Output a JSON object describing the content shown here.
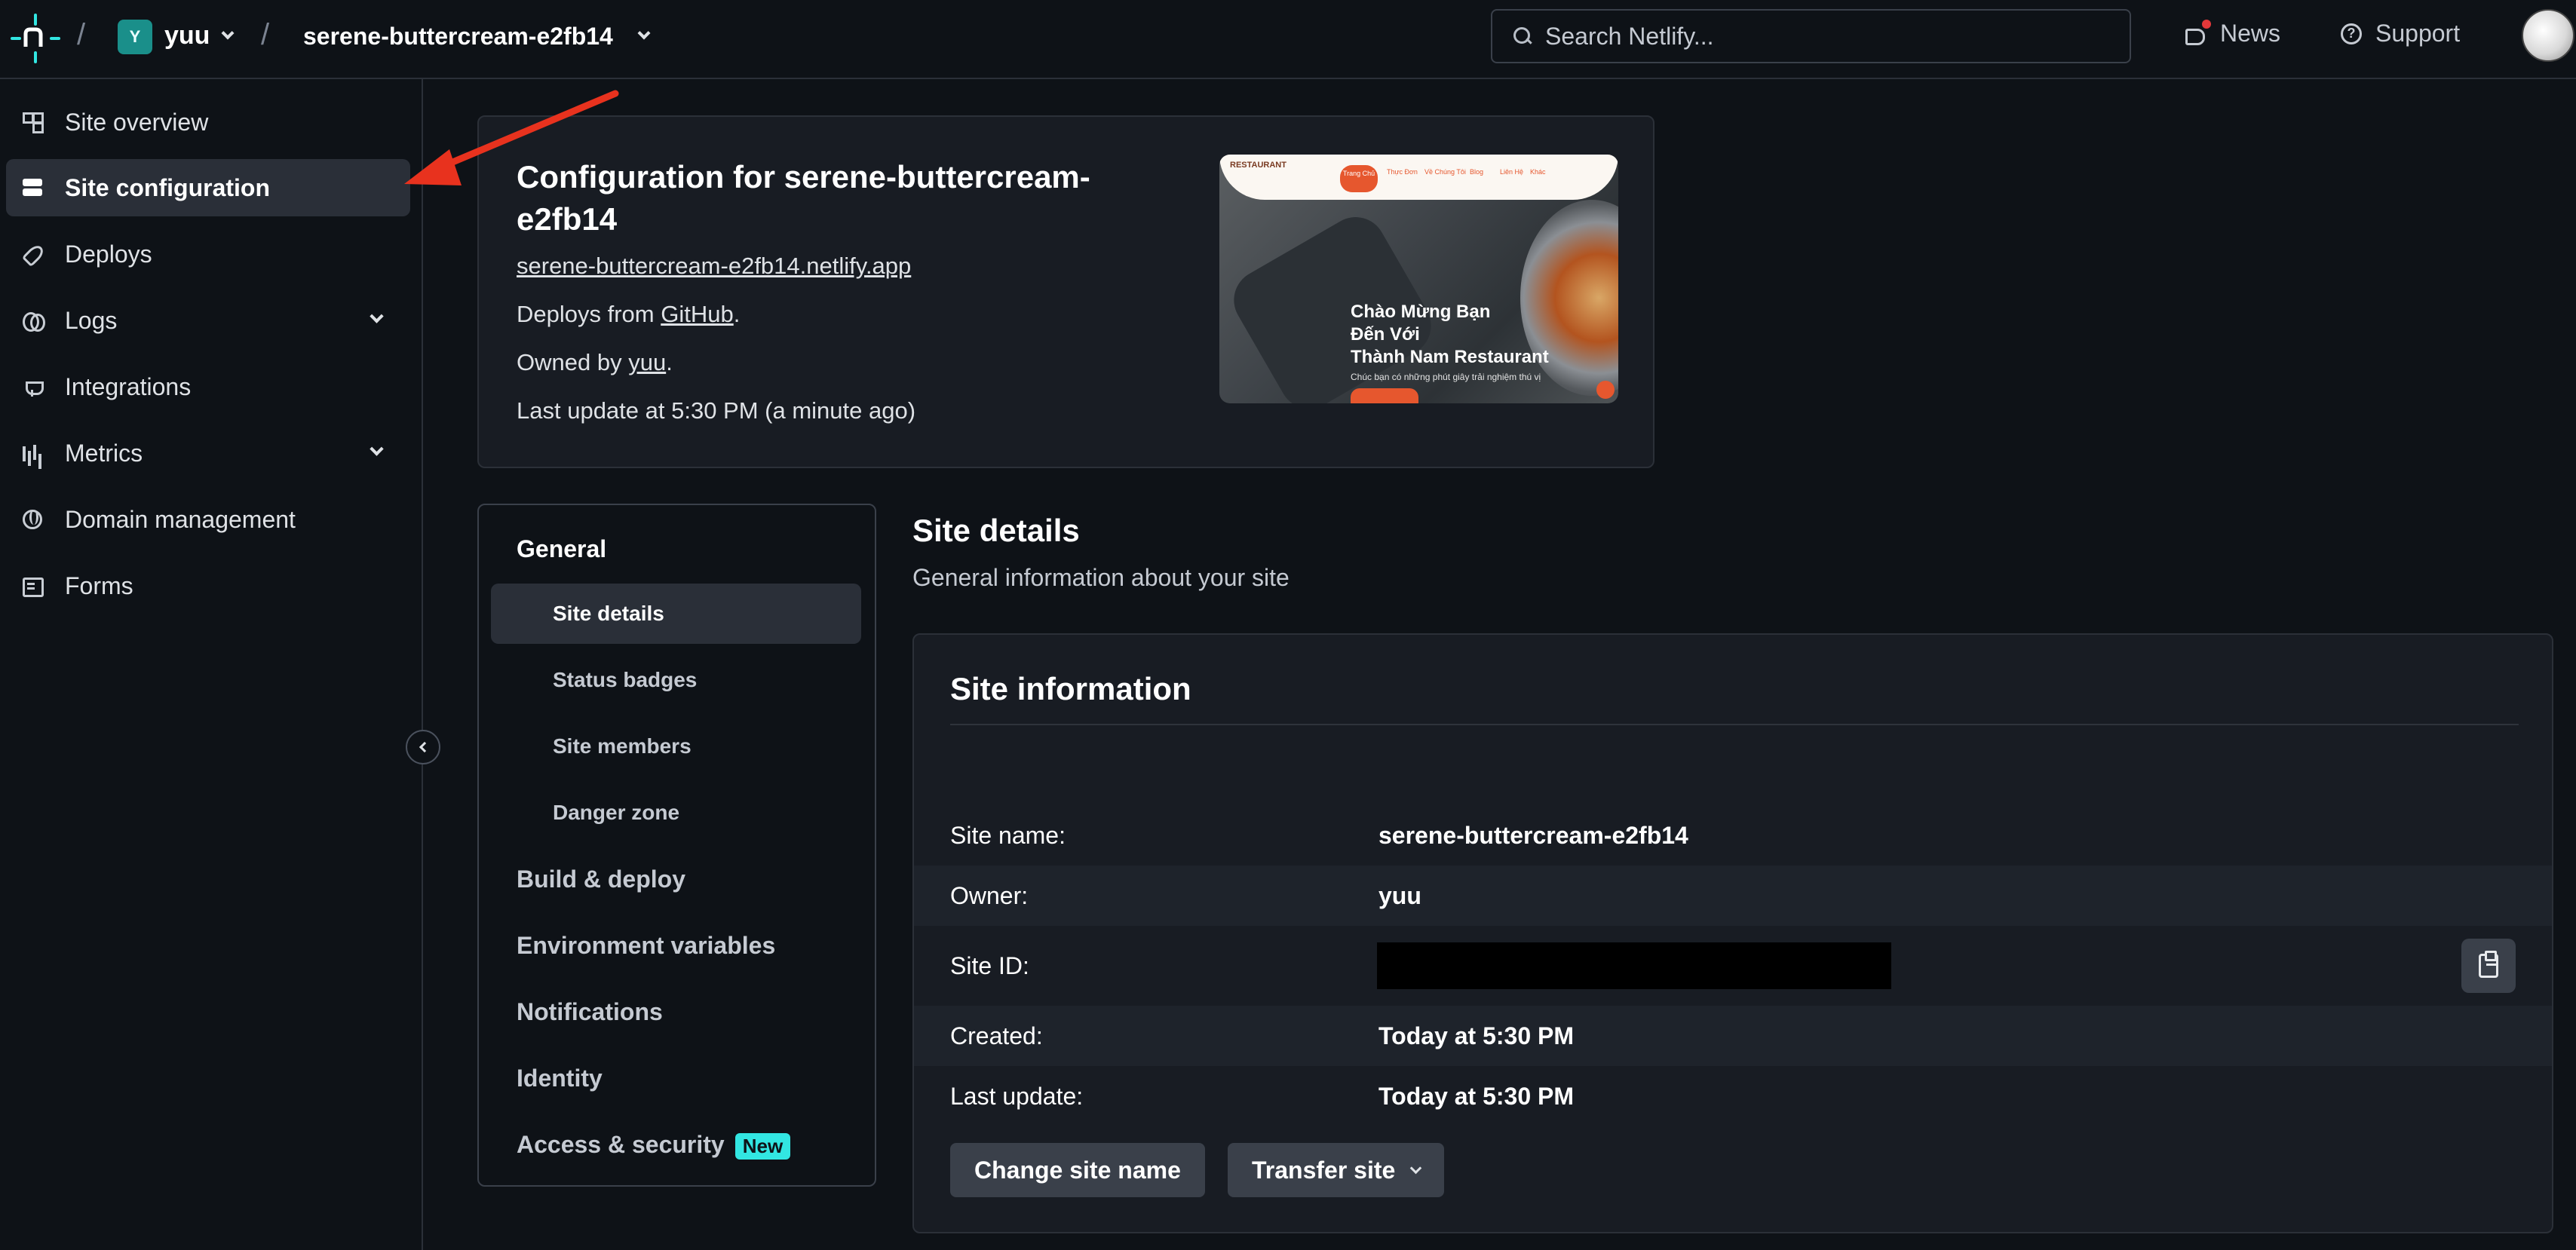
{
  "header": {
    "team_initial": "Y",
    "team_name": "yuu",
    "site_name": "serene-buttercream-e2fb14",
    "search_placeholder": "Search Netlify...",
    "news_label": "News",
    "support_label": "Support"
  },
  "sidebar": {
    "items": [
      {
        "label": "Site overview",
        "icon": "grid-icon"
      },
      {
        "label": "Site configuration",
        "icon": "config-icon",
        "active": true
      },
      {
        "label": "Deploys",
        "icon": "rocket-icon"
      },
      {
        "label": "Logs",
        "icon": "logs-icon",
        "expandable": true
      },
      {
        "label": "Integrations",
        "icon": "plug-icon"
      },
      {
        "label": "Metrics",
        "icon": "bar-chart-icon",
        "expandable": true
      },
      {
        "label": "Domain management",
        "icon": "globe-icon"
      },
      {
        "label": "Forms",
        "icon": "form-icon"
      }
    ]
  },
  "config": {
    "title": "Configuration for serene-buttercream-e2fb14",
    "url": "serene-buttercream-e2fb14.netlify.app",
    "deploys_prefix": "Deploys from ",
    "deploys_link": "GitHub",
    "deploys_suffix": ".",
    "owned_prefix": "Owned by ",
    "owned_link": "yuu",
    "owned_suffix": ".",
    "last_update": "Last update at 5:30 PM (a minute ago)",
    "preview": {
      "logo": "RESTAURANT",
      "nav_home": "Trang Chủ",
      "nav_links": [
        "Thực Đơn",
        "Về Chúng Tôi",
        "Blog",
        "Liên Hệ",
        "Khác"
      ],
      "headline_1": "Chào Mừng Bạn",
      "headline_2": "Đến Với",
      "headline_3": "Thành Nam Restaurant",
      "subtext": "Chúc bạn có những phút giây trải nghiệm thú vị"
    }
  },
  "subnav": {
    "general": "General",
    "items": [
      "Site details",
      "Status badges",
      "Site members",
      "Danger zone"
    ],
    "sections": [
      "Build & deploy",
      "Environment variables",
      "Notifications",
      "Identity",
      "Access & security"
    ],
    "new_badge": "New"
  },
  "details": {
    "title": "Site details",
    "subtitle": "General information about your site",
    "card_title": "Site information",
    "rows": [
      {
        "label": "Site name:",
        "value": "serene-buttercream-e2fb14"
      },
      {
        "label": "Owner:",
        "value": "yuu"
      },
      {
        "label": "Site ID:",
        "value": ""
      },
      {
        "label": "Created:",
        "value": "Today at 5:30 PM"
      },
      {
        "label": "Last update:",
        "value": "Today at 5:30 PM"
      }
    ],
    "change_name_button": "Change site name",
    "transfer_button": "Transfer site"
  },
  "colors": {
    "background": "#0e1217",
    "card": "#181c23",
    "accent_teal": "#32e6e2",
    "annotation_arrow": "#e8321e"
  }
}
